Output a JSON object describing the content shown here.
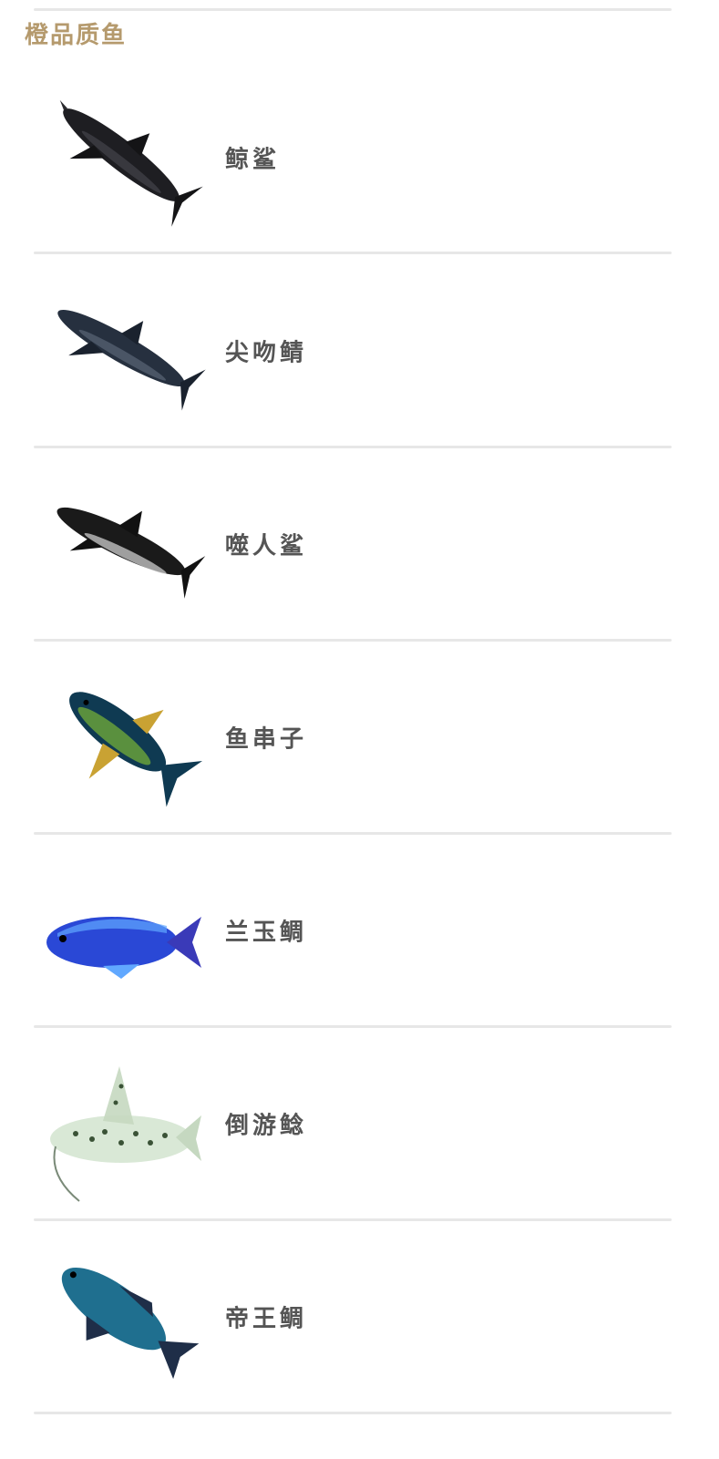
{
  "section": {
    "title": "橙品质鱼",
    "title_color": "#b59a6d"
  },
  "fish_list": [
    {
      "name": "鲸鲨",
      "icon": "shark-icon",
      "body_color": "#1e1e22",
      "accent_color": "#4a4a52"
    },
    {
      "name": "尖吻鲭",
      "icon": "mako-shark-icon",
      "body_color": "#26303f",
      "accent_color": "#5a6576"
    },
    {
      "name": "噬人鲨",
      "icon": "great-white-shark-icon",
      "body_color": "#1a1a1a",
      "accent_color": "#d9d9d9"
    },
    {
      "name": "鱼串子",
      "icon": "tuna-icon",
      "body_color": "#0f3a52",
      "accent_color": "#c9a233"
    },
    {
      "name": "兰玉鲷",
      "icon": "blue-cichlid-icon",
      "body_color": "#2a48d6",
      "accent_color": "#61a8ff"
    },
    {
      "name": "倒游鲶",
      "icon": "catfish-icon",
      "body_color": "#d9e8d6",
      "accent_color": "#3a5236"
    },
    {
      "name": "帝王鲷",
      "icon": "emperor-cichlid-icon",
      "body_color": "#1f6f8f",
      "accent_color": "#1f2e48"
    }
  ]
}
